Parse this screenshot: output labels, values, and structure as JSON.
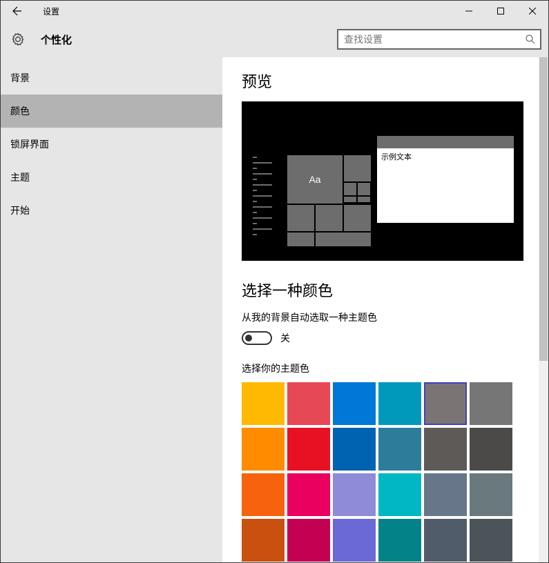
{
  "titlebar": {
    "title": "设置"
  },
  "header": {
    "title": "个性化"
  },
  "search": {
    "placeholder": "查找设置"
  },
  "sidebar": {
    "items": [
      {
        "label": "背景",
        "active": false
      },
      {
        "label": "颜色",
        "active": true
      },
      {
        "label": "锁屏界面",
        "active": false
      },
      {
        "label": "主题",
        "active": false
      },
      {
        "label": "开始",
        "active": false
      }
    ]
  },
  "content": {
    "preview_title": "预览",
    "preview_tile_text": "Aa",
    "preview_window_text": "示例文本",
    "choose_color_title": "选择一种颜色",
    "auto_accent_label": "从我的背景自动选取一种主题色",
    "toggle_state_label": "关",
    "accent_label": "选择你的主题色"
  },
  "colors": [
    {
      "hex": "#ffb900",
      "selected": false
    },
    {
      "hex": "#e74856",
      "selected": false
    },
    {
      "hex": "#0078d7",
      "selected": false
    },
    {
      "hex": "#0099bc",
      "selected": false
    },
    {
      "hex": "#7a7574",
      "selected": true
    },
    {
      "hex": "#767676",
      "selected": false
    },
    {
      "hex": "#ff8c00",
      "selected": false
    },
    {
      "hex": "#e81123",
      "selected": false
    },
    {
      "hex": "#0063b1",
      "selected": false
    },
    {
      "hex": "#2d7d9a",
      "selected": false
    },
    {
      "hex": "#5d5a58",
      "selected": false
    },
    {
      "hex": "#4c4a48",
      "selected": false
    },
    {
      "hex": "#f7630c",
      "selected": false
    },
    {
      "hex": "#ea005e",
      "selected": false
    },
    {
      "hex": "#8e8cd8",
      "selected": false
    },
    {
      "hex": "#00b7c3",
      "selected": false
    },
    {
      "hex": "#68768a",
      "selected": false
    },
    {
      "hex": "#69797e",
      "selected": false
    },
    {
      "hex": "#ca5010",
      "selected": false
    },
    {
      "hex": "#c30052",
      "selected": false
    },
    {
      "hex": "#6b69d6",
      "selected": false
    },
    {
      "hex": "#038387",
      "selected": false
    },
    {
      "hex": "#515c6b",
      "selected": false
    },
    {
      "hex": "#4a5459",
      "selected": false
    }
  ]
}
